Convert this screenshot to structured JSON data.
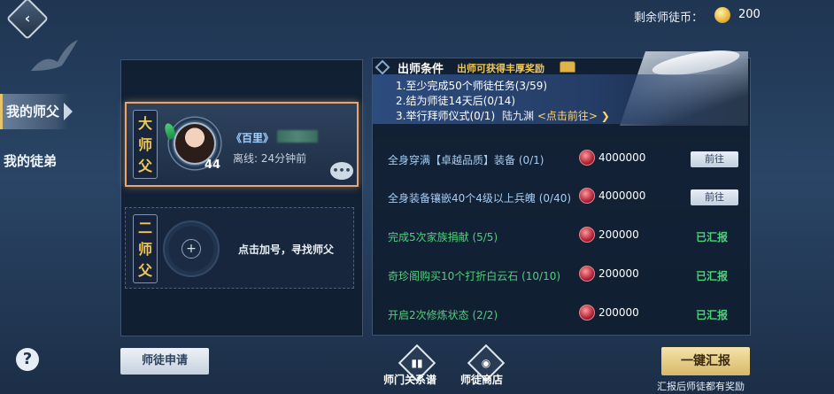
{
  "currency": {
    "label": "剩余师徒币：",
    "value": "200",
    "icon": "coin-icon"
  },
  "sidebar": {
    "tabs": [
      {
        "label": "我的师父",
        "active": true
      },
      {
        "label": "我的徒弟",
        "active": false
      }
    ],
    "help_icon": "?"
  },
  "masters": {
    "primary": {
      "rank_label": "大师父",
      "server_tag": "《百里》",
      "level": "44",
      "status": "离线: 24分钟前"
    },
    "secondary": {
      "rank_label": "二师父",
      "hint": "点击加号，寻找师父"
    }
  },
  "conditions": {
    "title": "出师条件",
    "subtitle": "出师可获得丰厚奖励",
    "requirements": [
      "1.至少完成50个师徒任务(3/59)",
      "2.结为师徒14天后(0/14)",
      "3.举行拜师仪式(0/1)"
    ],
    "npc_name": "陆九渊",
    "npc_link": "<点击前往>"
  },
  "tasks": [
    {
      "name": "全身穿满【卓越品质】装备 (0/1)",
      "reward": "4000000",
      "action": "前往",
      "done": false
    },
    {
      "name": "全身装备镶嵌40个4级以上兵魄 (0/40)",
      "reward": "4000000",
      "action": "前往",
      "done": false
    },
    {
      "name": "完成5次家族捐献 (5/5)",
      "reward": "200000",
      "action": "已汇报",
      "done": true
    },
    {
      "name": "奇珍阁购买10个打折白云石 (10/10)",
      "reward": "200000",
      "action": "已汇报",
      "done": true
    },
    {
      "name": "开启2次修炼状态 (2/2)",
      "reward": "200000",
      "action": "已汇报",
      "done": true
    }
  ],
  "bottom": {
    "apply_label": "师徒申请",
    "relation_label": "师门关系谱",
    "shop_label": "师徒商店",
    "report_label": "一键汇报",
    "report_note": "汇报后师徒都有奖励"
  }
}
